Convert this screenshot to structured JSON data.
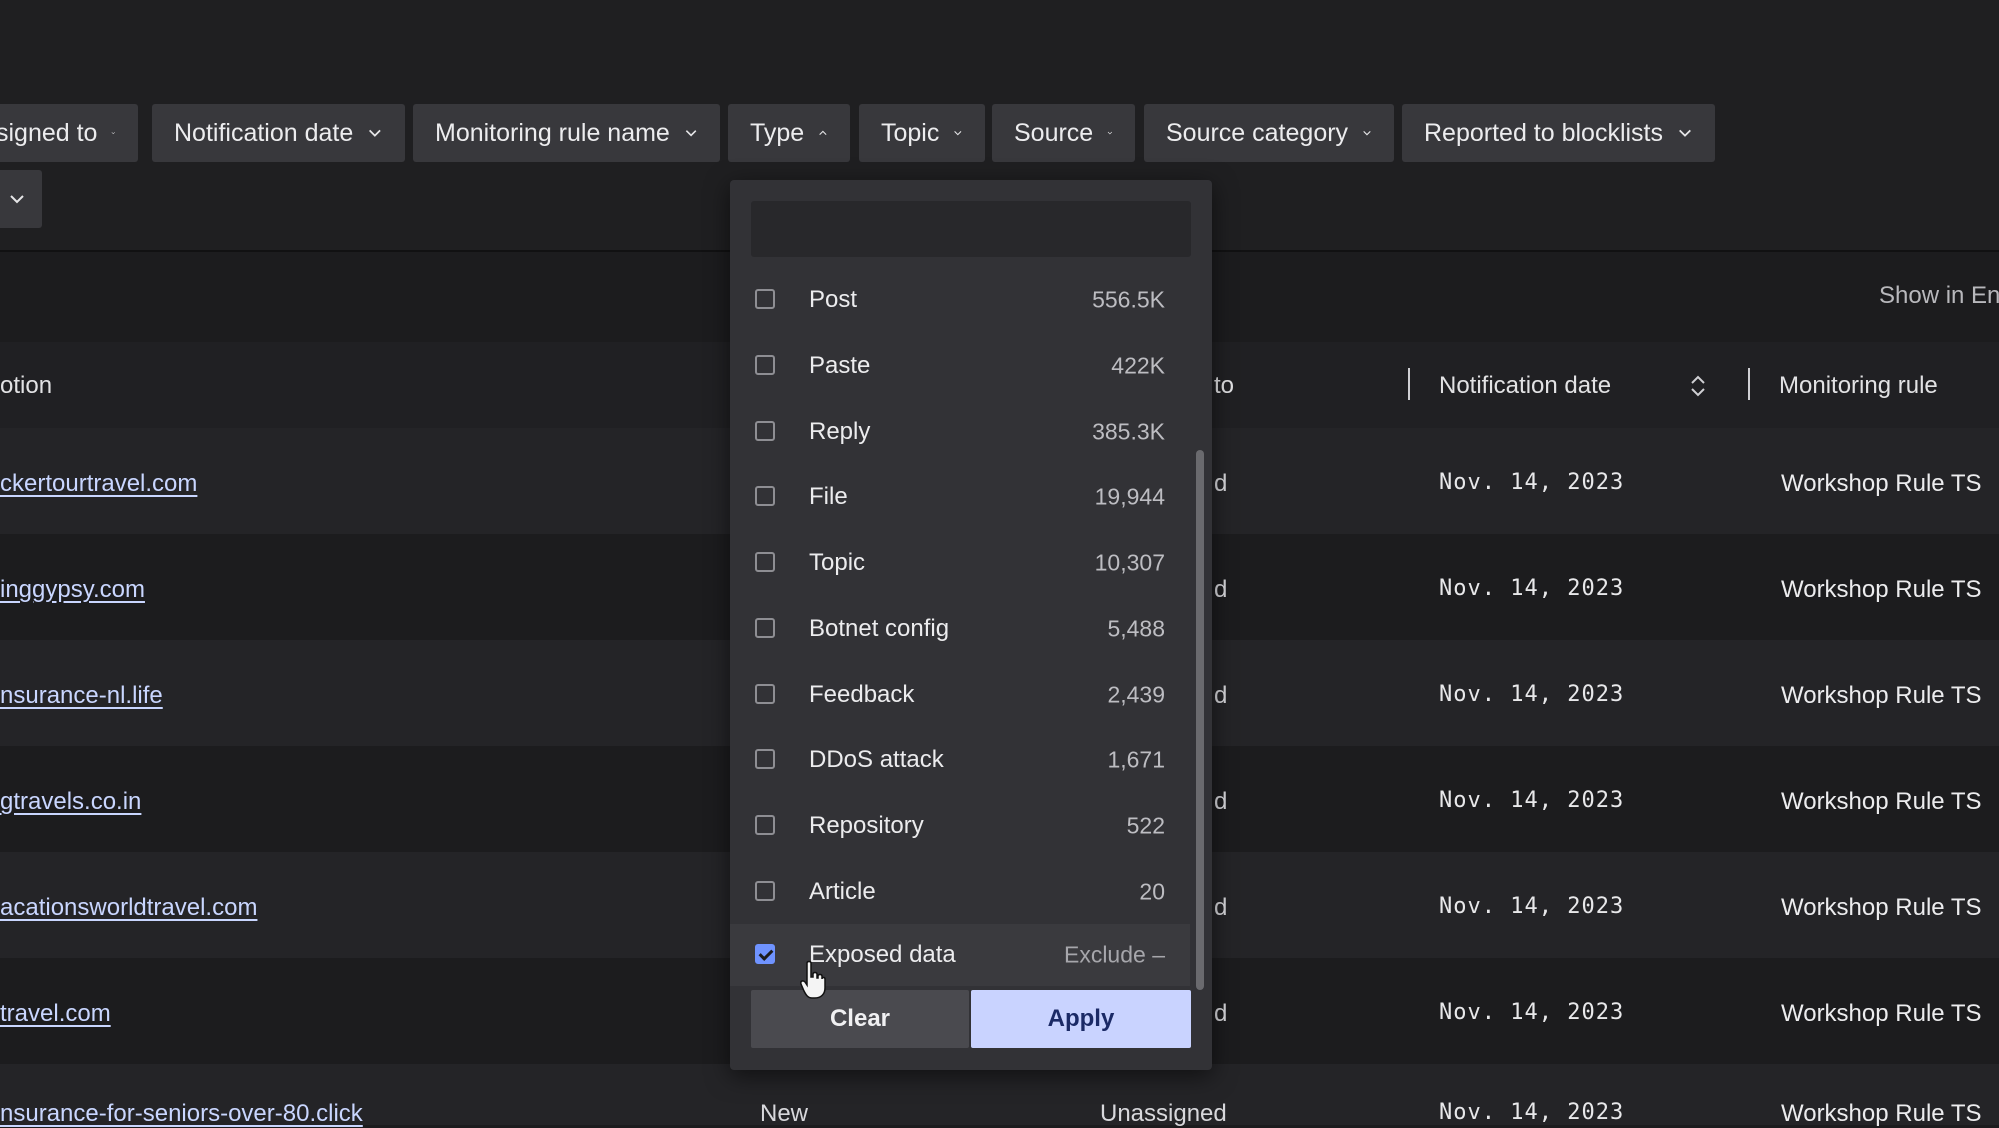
{
  "filters": {
    "chips": [
      {
        "label": "signed to"
      },
      {
        "label": "Notification date"
      },
      {
        "label": "Monitoring rule name"
      },
      {
        "label": "Type"
      },
      {
        "label": "Topic"
      },
      {
        "label": "Source"
      },
      {
        "label": "Source category"
      },
      {
        "label": "Reported to blocklists"
      }
    ]
  },
  "toolbar": {
    "show_link": "Show in En"
  },
  "table": {
    "headers": {
      "description": "otion",
      "assigned": "to",
      "notification_date": "Notification date",
      "monitoring_rule": "Monitoring rule"
    },
    "rows": [
      {
        "link": "ckertourtravel.com",
        "assigned": "d",
        "date": "Nov. 14, 2023",
        "rule": "Workshop Rule TS"
      },
      {
        "link": "inggypsy.com",
        "assigned": "d",
        "date": "Nov. 14, 2023",
        "rule": "Workshop Rule TS"
      },
      {
        "link": "nsurance-nl.life",
        "assigned": "d",
        "date": "Nov. 14, 2023",
        "rule": "Workshop Rule TS"
      },
      {
        "link": "gtravels.co.in",
        "assigned": "d",
        "date": "Nov. 14, 2023",
        "rule": "Workshop Rule TS"
      },
      {
        "link": "acationsworldtravel.com",
        "assigned": "d",
        "date": "Nov. 14, 2023",
        "rule": "Workshop Rule TS"
      },
      {
        "link": "travel.com",
        "assigned": "d",
        "date": "Nov. 14, 2023",
        "rule": "Workshop Rule TS"
      },
      {
        "link": "nsurance-for-seniors-over-80.click",
        "status": "New",
        "assigned": "Unassigned",
        "date": "Nov. 14, 2023",
        "rule": "Workshop Rule TS"
      }
    ]
  },
  "type_dropdown": {
    "search_value": "",
    "options": [
      {
        "label": "Post",
        "count": "556.5K",
        "checked": false
      },
      {
        "label": "Paste",
        "count": "422K",
        "checked": false
      },
      {
        "label": "Reply",
        "count": "385.3K",
        "checked": false
      },
      {
        "label": "File",
        "count": "19,944",
        "checked": false
      },
      {
        "label": "Topic",
        "count": "10,307",
        "checked": false
      },
      {
        "label": "Botnet config",
        "count": "5,488",
        "checked": false
      },
      {
        "label": "Feedback",
        "count": "2,439",
        "checked": false
      },
      {
        "label": "DDoS attack",
        "count": "1,671",
        "checked": false
      },
      {
        "label": "Repository",
        "count": "522",
        "checked": false
      },
      {
        "label": "Article",
        "count": "20",
        "checked": false
      },
      {
        "label": "Exposed data",
        "count": "Exclude –",
        "checked": true
      }
    ],
    "clear_label": "Clear",
    "apply_label": "Apply"
  },
  "colors": {
    "background": "#1c1c1e",
    "chip": "#38383c",
    "link": "#c9d6ff",
    "apply": "#c9d3ff",
    "checkbox_checked": "#6f93ff"
  }
}
